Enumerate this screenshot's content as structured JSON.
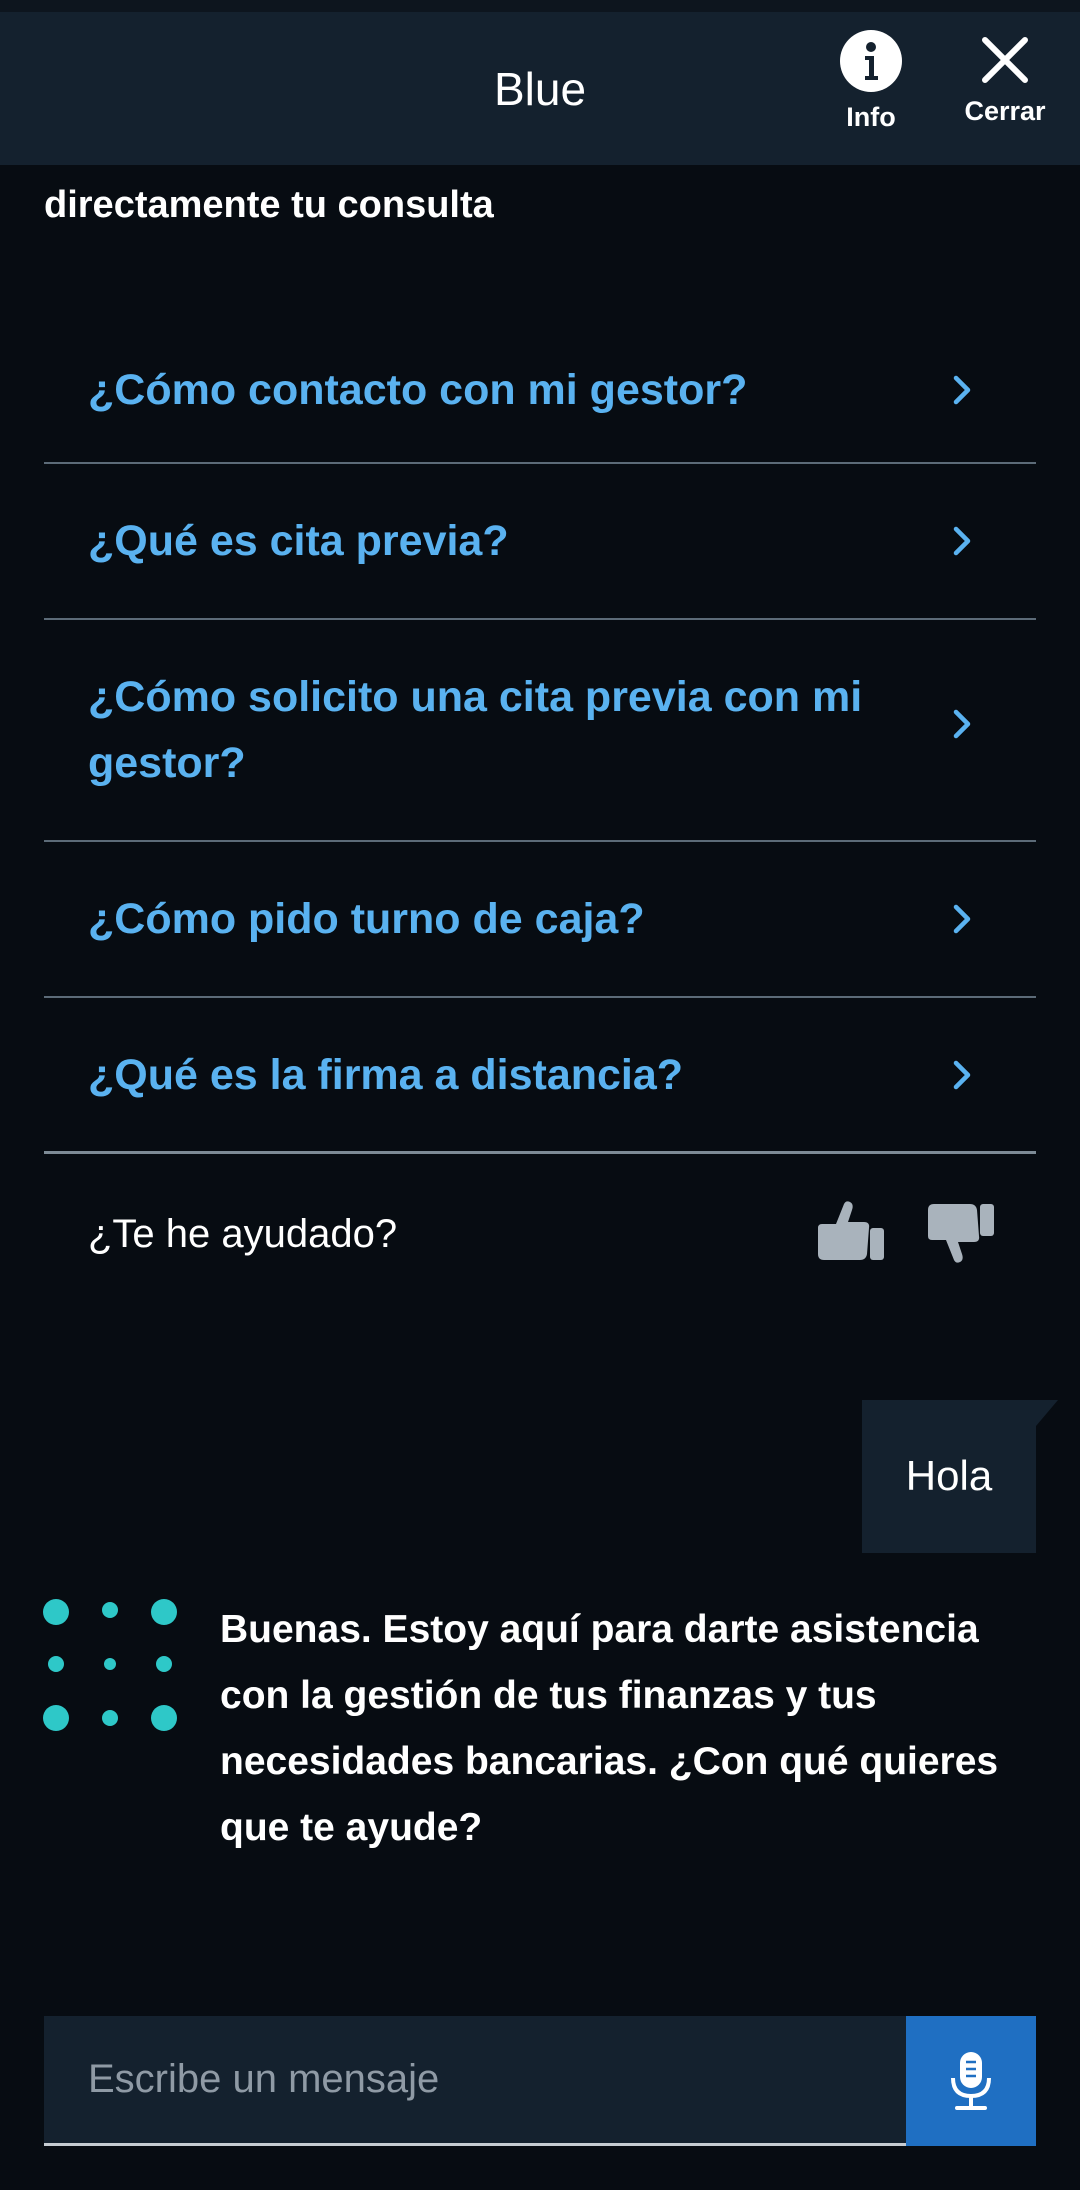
{
  "header": {
    "title": "Blue",
    "info_label": "Info",
    "close_label": "Cerrar"
  },
  "conversation": {
    "clipped_text": "directamente tu consulta",
    "suggestions": [
      {
        "label": "¿Cómo contacto con mi gestor?"
      },
      {
        "label": "¿Qué es cita previa?"
      },
      {
        "label": "¿Cómo solicito una cita previa con mi gestor?"
      },
      {
        "label": "¿Cómo pido turno de caja?"
      },
      {
        "label": "¿Qué es la firma a distancia?"
      }
    ],
    "feedback_question": "¿Te he ayudado?",
    "user_message": "Hola",
    "bot_message": "Buenas. Estoy aquí para darte asistencia con la gestión de tus finanzas y tus necesidades bancarias. ¿Con qué quieres que te ayude?"
  },
  "composer": {
    "placeholder": "Escribe un mensaje"
  },
  "icons": {
    "info": "info-icon",
    "close": "close-icon",
    "chevron": "chevron-right-icon",
    "thumb_up": "thumbs-up-icon",
    "thumb_down": "thumbs-down-icon",
    "bot_avatar": "dots-avatar-icon",
    "mic": "microphone-icon"
  },
  "colors": {
    "background": "#070c12",
    "header": "#14212e",
    "link": "#5ab2f0",
    "accent_teal": "#2ec8c8",
    "mic_button": "#1f6fc2"
  }
}
